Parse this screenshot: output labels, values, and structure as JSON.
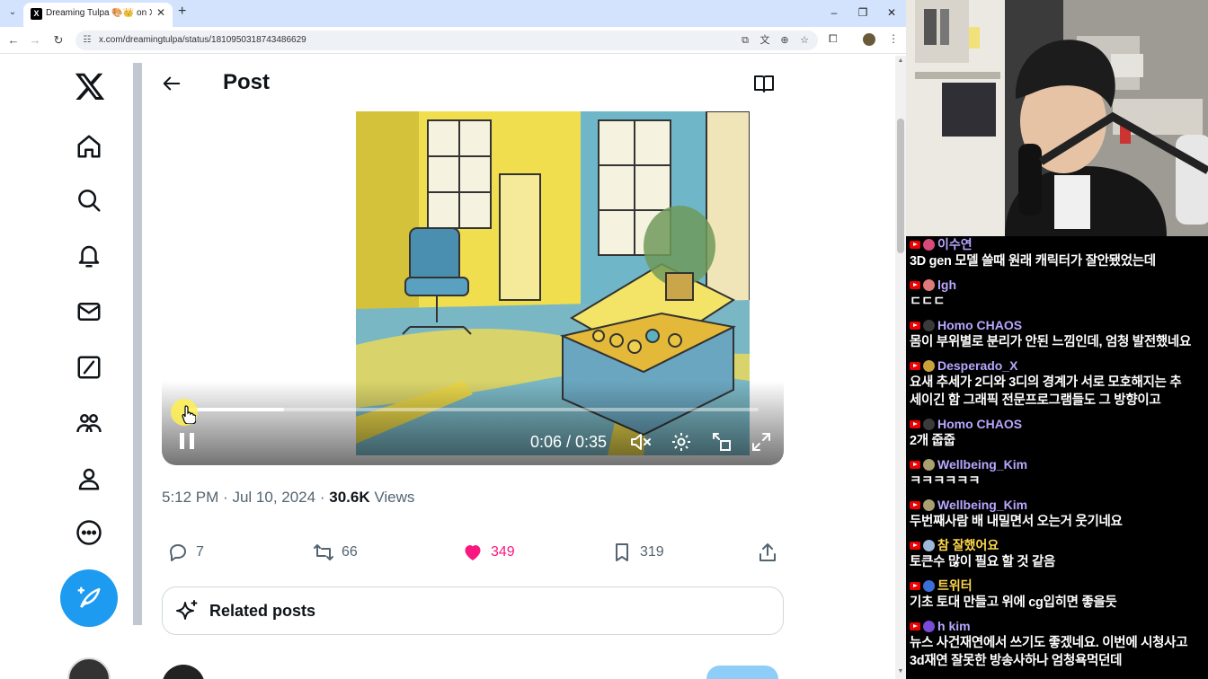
{
  "browser": {
    "tab_title": "Dreaming Tulpa 🎨👑 on X: \"",
    "tab_favicon": "X",
    "url": "x.com/dreamingtulpa/status/1810950318743486629",
    "window_controls": [
      "–",
      "❐",
      "✕"
    ]
  },
  "sidebar": {
    "items": [
      {
        "name": "home-icon"
      },
      {
        "name": "search-icon"
      },
      {
        "name": "bell-icon"
      },
      {
        "name": "mail-icon"
      },
      {
        "name": "grok-icon"
      },
      {
        "name": "communities-icon"
      },
      {
        "name": "profile-icon"
      },
      {
        "name": "more-icon"
      }
    ],
    "compose": "compose-icon"
  },
  "post": {
    "header_title": "Post",
    "video": {
      "current_time": "0:06",
      "duration": "0:35",
      "time_display": "0:06 / 0:35",
      "progress": 0.17,
      "state": "playing",
      "muted": true
    },
    "meta": {
      "time": "5:12 PM",
      "date": "Jul 10, 2024",
      "views_count": "30.6K",
      "views_label": "Views",
      "sep": "·"
    },
    "actions": {
      "replies": "7",
      "reposts": "66",
      "likes": "349",
      "bookmarks": "319"
    },
    "related_label": "Related posts"
  },
  "colors": {
    "accent": "#1d9bf0",
    "like": "#f91880",
    "muted_text": "#536471"
  },
  "chat": {
    "messages": [
      {
        "user": "이수연",
        "text": "3D gen 모델 쓸때 원래 캐릭터가 잘안됐었는데",
        "avatar_color": "#d94a7a"
      },
      {
        "user": "lgh",
        "text": "ㄷㄷㄷ",
        "avatar_color": "#e07a7a"
      },
      {
        "user": "Homo CHAOS",
        "text": "몸이 부위별로 분리가 안된 느낌인데, 엄청 발전했네요",
        "avatar_color": "#3a3a3a"
      },
      {
        "user": "Desperado_X",
        "text": "요새 추세가 2디와 3디의 경계가 서로 모호해지는 추",
        "text2": "세이긴 함 그래픽 전문프로그램들도 그 방향이고",
        "avatar_color": "#c9a23a"
      },
      {
        "user": "Homo CHAOS",
        "text": "2개 줍줍",
        "avatar_color": "#3a3a3a"
      },
      {
        "user": "Wellbeing_Kim",
        "text": "ㅋㅋㅋㅋㅋㅋ",
        "avatar_color": "#a8a070"
      },
      {
        "user": "Wellbeing_Kim",
        "text": "두번째사람 배 내밀면서 오는거 웃기네요",
        "avatar_color": "#a8a070"
      },
      {
        "user": "참 잘했어요",
        "text": "토큰수 많이 필요 할 것 같음",
        "avatar_color": "#9fb7d8",
        "gold": true
      },
      {
        "user": "트위터",
        "text": "기초 토대 만들고 위에 cg입히면 좋을듯",
        "avatar_color": "#3b6fd8",
        "gold": true
      },
      {
        "user": "h kim",
        "text": "뉴스 사건재연에서 쓰기도 좋겠네요. 이번에 시청사고",
        "text2": "3d재연 잘못한 방송사하나 엄청욕먹던데",
        "avatar_color": "#7a4ad8"
      }
    ]
  }
}
